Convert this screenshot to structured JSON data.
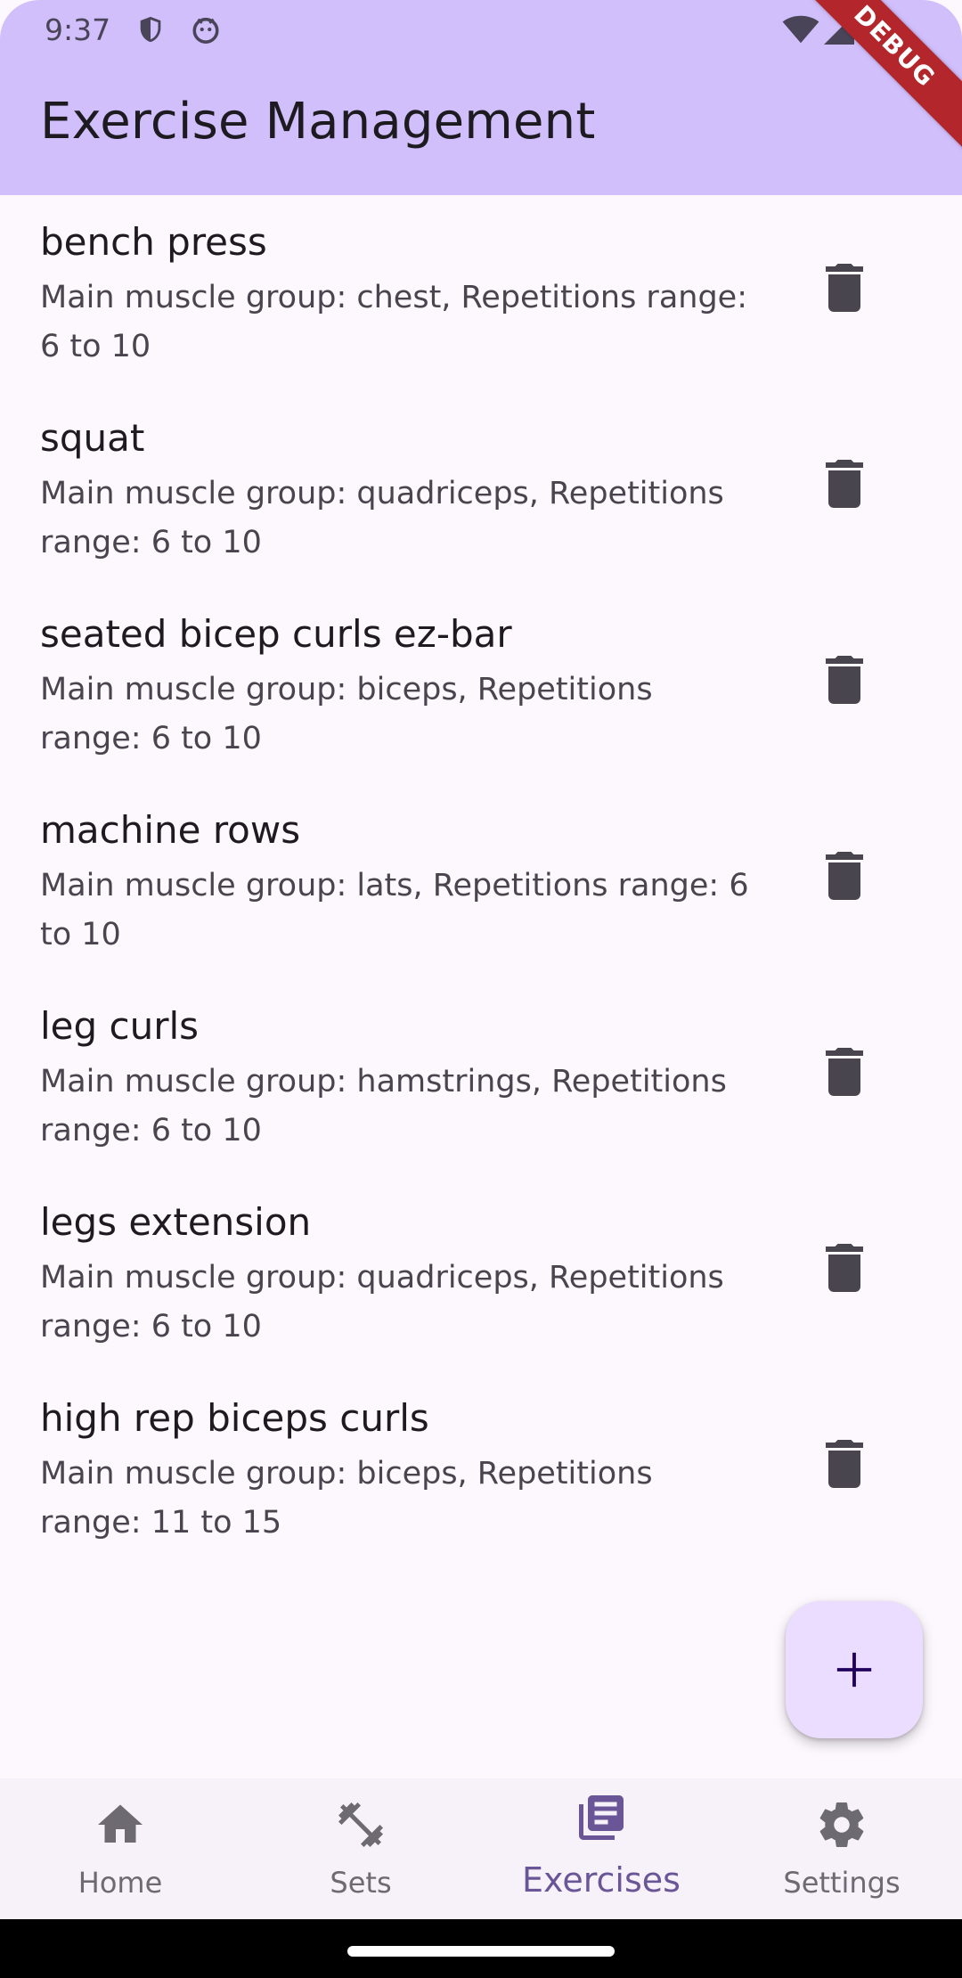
{
  "status_bar": {
    "time": "9:37"
  },
  "app_bar": {
    "title": "Exercise Management",
    "debug_label": "DEBUG"
  },
  "exercises": [
    {
      "name": "bench press",
      "description": "Main muscle group: chest, Repetitions range: 6 to 10"
    },
    {
      "name": "squat",
      "description": "Main muscle group: quadriceps, Repetitions range: 6 to 10"
    },
    {
      "name": "seated bicep curls ez-bar",
      "description": "Main muscle group: biceps, Repetitions range: 6 to 10"
    },
    {
      "name": "machine rows",
      "description": "Main muscle group: lats, Repetitions range: 6 to 10"
    },
    {
      "name": "leg curls",
      "description": "Main muscle group: hamstrings, Repetitions range: 6 to 10"
    },
    {
      "name": "legs extension",
      "description": "Main muscle group: quadriceps, Repetitions range: 6 to 10"
    },
    {
      "name": "high rep biceps curls",
      "description": "Main muscle group: biceps, Repetitions range: 11 to 15"
    }
  ],
  "fab": {
    "icon": "plus-icon"
  },
  "bottom_nav": {
    "items": [
      {
        "label": "Home",
        "icon": "home-icon"
      },
      {
        "label": "Sets",
        "icon": "dumbbell-icon"
      },
      {
        "label": "Exercises",
        "icon": "library-books-icon",
        "active": true
      },
      {
        "label": "Settings",
        "icon": "gear-icon"
      }
    ]
  },
  "colors": {
    "app_bar": "#D1BFFC",
    "background": "#FDF7FE",
    "fab": "#EADDFF",
    "active_nav": "#6A5696",
    "icon": "#49454F",
    "debug_banner": "#B3262B"
  }
}
